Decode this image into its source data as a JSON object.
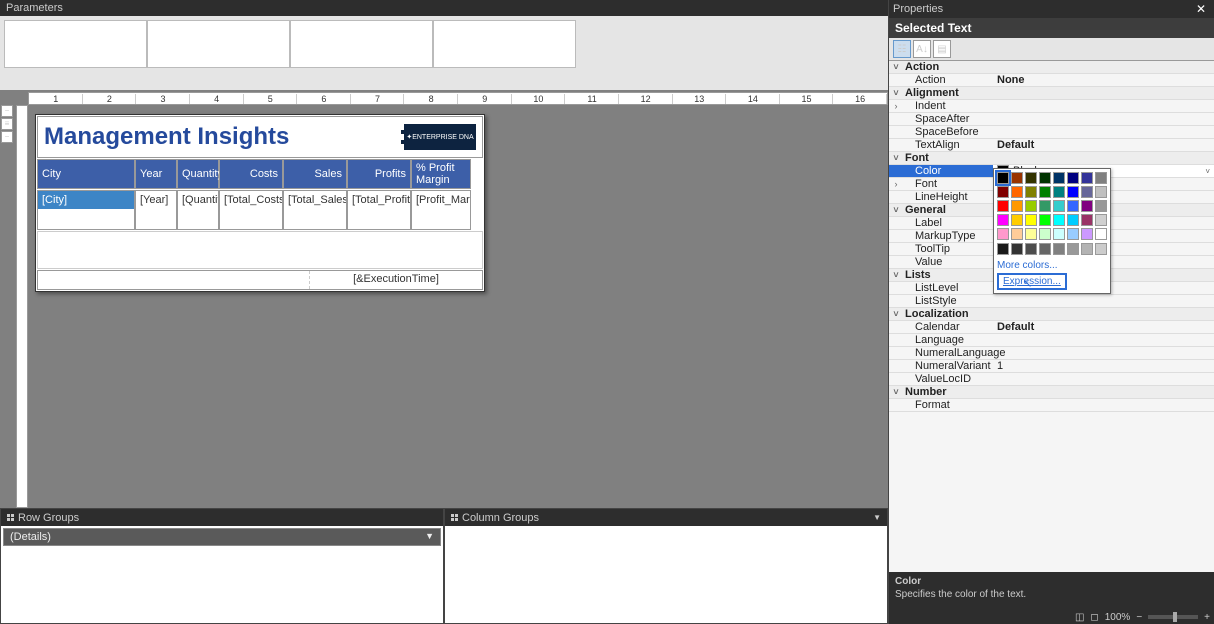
{
  "panels": {
    "parameters_title": "Parameters",
    "row_groups_title": "Row Groups",
    "column_groups_title": "Column Groups",
    "properties_title": "Properties",
    "selected_text_title": "Selected Text"
  },
  "ruler_marks": [
    "1",
    "2",
    "3",
    "4",
    "5",
    "6",
    "7",
    "8",
    "9",
    "10",
    "11",
    "12",
    "13",
    "14",
    "15",
    "16"
  ],
  "report": {
    "title": "Management Insights",
    "logo_text": "ENTERPRISE DNA",
    "headers": {
      "city": "City",
      "year": "Year",
      "qty": "Quantity",
      "costs": "Costs",
      "sales": "Sales",
      "profits": "Profits",
      "margin": "% Profit Margin"
    },
    "cells": {
      "city": "[City]",
      "year": "[Year]",
      "qty": "[Quantity]",
      "costs": "[Total_Costs]",
      "sales": "[Total_Sales]",
      "profits": "[Total_Profits]",
      "margin": "[Profit_Margin]"
    },
    "footer_exec_time": "[&ExecutionTime]"
  },
  "row_groups": {
    "details": "(Details)"
  },
  "properties": {
    "cat_action": "Action",
    "action_label": "Action",
    "action_value": "None",
    "cat_alignment": "Alignment",
    "indent": "Indent",
    "spaceafter": "SpaceAfter",
    "spacebefore": "SpaceBefore",
    "textalign": "TextAlign",
    "textalign_value": "Default",
    "cat_font": "Font",
    "color": "Color",
    "color_value": "Black",
    "font": "Font",
    "lineheight": "LineHeight",
    "cat_general": "General",
    "label": "Label",
    "markuptype": "MarkupType",
    "tooltip": "ToolTip",
    "value": "Value",
    "cat_lists": "Lists",
    "listlevel": "ListLevel",
    "liststyle": "ListStyle",
    "cat_localization": "Localization",
    "calendar": "Calendar",
    "calendar_value": "Default",
    "language": "Language",
    "numerallanguage": "NumeralLanguage",
    "numeralvariant": "NumeralVariant",
    "numeralvariant_value": "1",
    "valuelocid": "ValueLocID",
    "cat_number": "Number",
    "format": "Format"
  },
  "color_picker": {
    "more_colors": "More colors...",
    "expression": "Expression..."
  },
  "prop_desc": {
    "title": "Color",
    "text": "Specifies the color of the text."
  },
  "status": {
    "zoom": "100%",
    "minus": "−",
    "plus": "+"
  },
  "colors": {
    "row0": [
      "#000000",
      "#993300",
      "#333300",
      "#003300",
      "#003366",
      "#000080",
      "#333399",
      "#808080"
    ],
    "row1": [
      "#800000",
      "#ff6600",
      "#808000",
      "#008000",
      "#008080",
      "#0000ff",
      "#666699",
      "#c0c0c0"
    ],
    "row2": [
      "#ff0000",
      "#ff9900",
      "#99cc00",
      "#339966",
      "#33cccc",
      "#3366ff",
      "#800080",
      "#999999"
    ],
    "row3": [
      "#ff00ff",
      "#ffcc00",
      "#ffff00",
      "#00ff00",
      "#00ffff",
      "#00ccff",
      "#993366",
      "#d0d0d0"
    ],
    "row4": [
      "#ff99cc",
      "#ffcc99",
      "#ffff99",
      "#ccffcc",
      "#ccffff",
      "#99ccff",
      "#cc99ff",
      "#ffffff"
    ],
    "grays": [
      "#1a1a1a",
      "#333333",
      "#4d4d4d",
      "#666666",
      "#808080",
      "#999999",
      "#b3b3b3",
      "#cccccc"
    ]
  }
}
